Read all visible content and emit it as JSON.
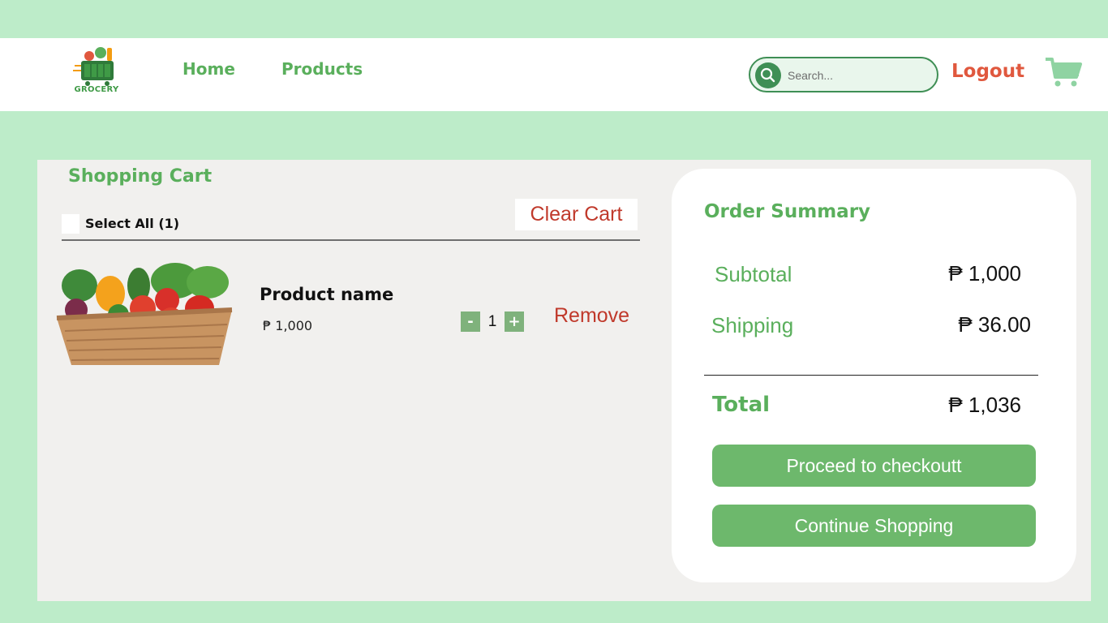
{
  "header": {
    "logo_text": "GROCERY",
    "nav": {
      "home": "Home",
      "products": "Products"
    },
    "search": {
      "placeholder": "Search..."
    },
    "logout": "Logout"
  },
  "cart": {
    "title": "Shopping Cart",
    "select_all": "Select All (1)",
    "clear_cart": "Clear Cart",
    "items": [
      {
        "name": "Product name",
        "price": "₱ 1,000",
        "quantity": "1",
        "minus": "-",
        "plus": "+",
        "remove": "Remove"
      }
    ]
  },
  "summary": {
    "title": "Order Summary",
    "subtotal_label": "Subtotal",
    "subtotal_value": "₱ 1,000",
    "shipping_label": "Shipping",
    "shipping_value": "₱ 36.00",
    "total_label": "Total",
    "total_value": "₱ 1,036",
    "checkout_button": "Proceed to checkoutt",
    "continue_button": "Continue Shopping"
  },
  "colors": {
    "background": "#bdecc9",
    "brand_green": "#5aaf5c",
    "button_green": "#6db86c",
    "danger_red": "#c0392b",
    "logout_orange": "#e0583e"
  },
  "icons": [
    "grocery-logo-icon",
    "search-icon",
    "shopping-cart-icon",
    "vegetable-basket-image"
  ]
}
